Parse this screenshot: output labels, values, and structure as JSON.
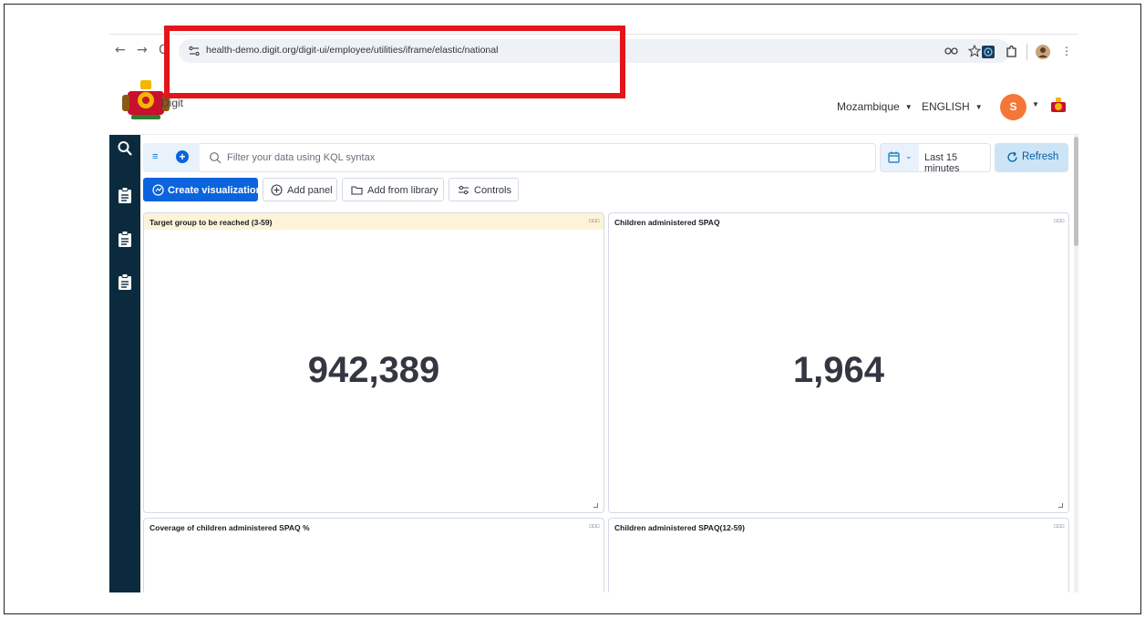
{
  "browser": {
    "back_glyph": "←",
    "forward_glyph": "→",
    "reload_glyph": "C",
    "url": "health-demo.digit.org/digit-ui/employee/utilities/iframe/elastic/national",
    "icons": [
      "site-info-icon",
      "password-key-icon",
      "bookmark-star-icon",
      "extension-icon",
      "puzzle-icon",
      "profile-icon",
      "kebab-menu-icon"
    ],
    "accent": "#e3151a"
  },
  "header": {
    "brand": "Digit",
    "country": "Mozambique",
    "language": "ENGLISH",
    "avatar_initial": "S",
    "avatar_color": "#f47738"
  },
  "sidebar": {
    "items": [
      {
        "icon": "search-icon"
      },
      {
        "icon": "clipboard-icon"
      },
      {
        "icon": "clipboard-icon"
      },
      {
        "icon": "clipboard-icon"
      }
    ],
    "color": "#0b2a3d"
  },
  "query": {
    "placeholder": "Filter your data using KQL syntax",
    "time_range": "Last 15 minutes",
    "refresh_label": "Refresh"
  },
  "actions": {
    "create_visualization": "Create visualization",
    "add_panel": "Add panel",
    "add_from_library": "Add from library",
    "controls": "Controls"
  },
  "panels": [
    {
      "title": "Target group to be reached (3-59)",
      "value": "942,389"
    },
    {
      "title": "Children administered SPAQ",
      "value": "1,964"
    },
    {
      "title": "Coverage of children administered SPAQ %",
      "value": ""
    },
    {
      "title": "Children administered SPAQ(12-59)",
      "value": ""
    }
  ],
  "panel_menu_glyph": "▫▫▫"
}
